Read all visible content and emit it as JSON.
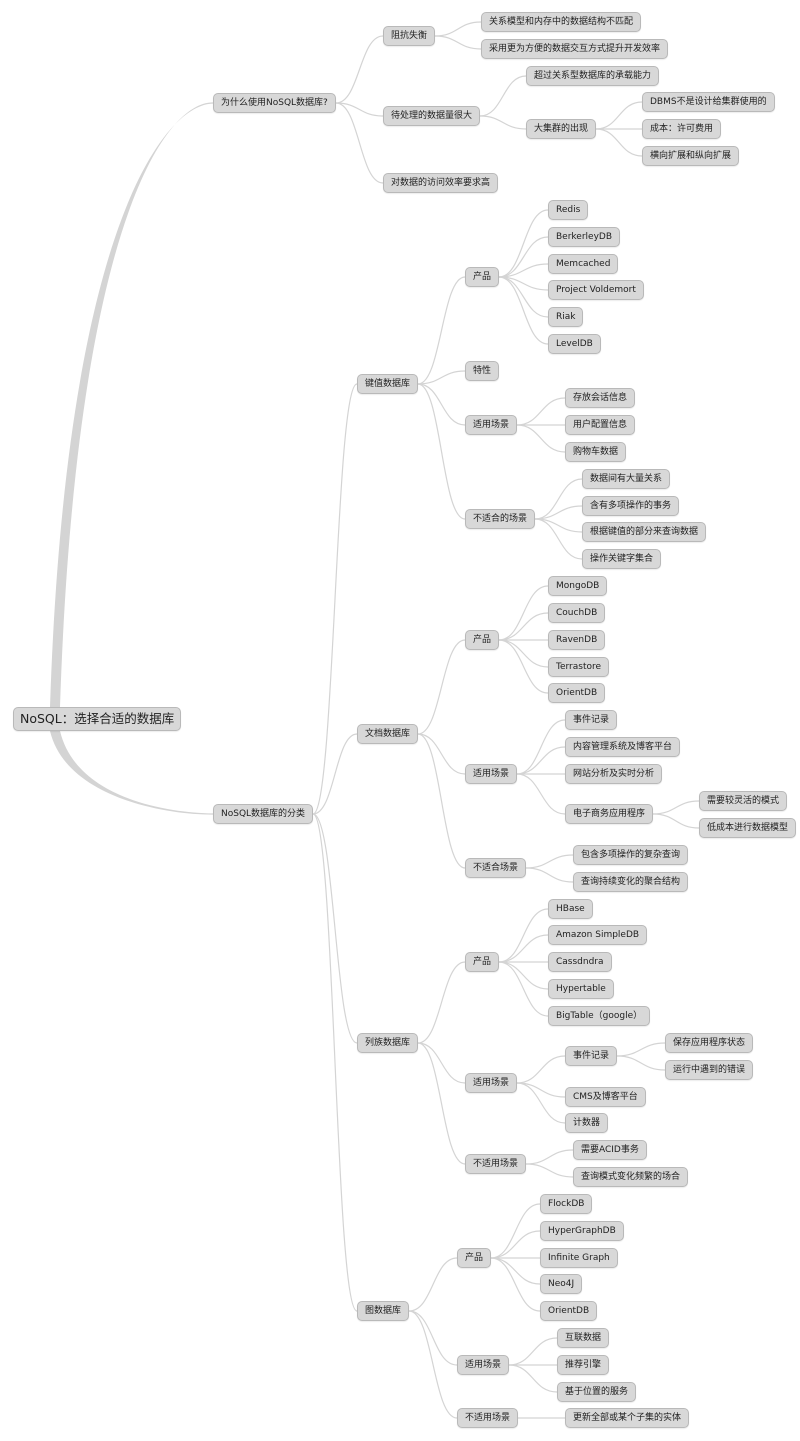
{
  "mindmap": {
    "title": "NoSQL：选择合适的数据库",
    "colors": {
      "node_fill": "#d8d8d8",
      "node_border": "#b9b9b9",
      "link": "#d4d4d4",
      "text": "#222222"
    },
    "root": {
      "id": "root",
      "label": "NoSQL：选择合适的数据库",
      "children": [
        {
          "id": "why",
          "label": "为什么使用NoSQL数据库?",
          "children": [
            {
              "id": "why-1",
              "label": "阻抗失衡",
              "children": [
                {
                  "id": "why-1-1",
                  "label": "关系模型和内存中的数据结构不匹配"
                },
                {
                  "id": "why-1-2",
                  "label": "采用更为方便的数据交互方式提升开发效率"
                }
              ]
            },
            {
              "id": "why-2",
              "label": "待处理的数据量很大",
              "children": [
                {
                  "id": "why-2-1",
                  "label": "超过关系型数据库的承载能力"
                },
                {
                  "id": "why-2-2",
                  "label": "大集群的出现",
                  "children": [
                    {
                      "id": "why-2-2-1",
                      "label": "DBMS不是设计给集群使用的"
                    },
                    {
                      "id": "why-2-2-2",
                      "label": "成本：许可费用"
                    },
                    {
                      "id": "why-2-2-3",
                      "label": "横向扩展和纵向扩展"
                    }
                  ]
                }
              ]
            },
            {
              "id": "why-3",
              "label": "对数据的访问效率要求高"
            }
          ]
        },
        {
          "id": "cat",
          "label": "NoSQL数据库的分类",
          "children": [
            {
              "id": "kv",
              "label": "键值数据库",
              "children": [
                {
                  "id": "kv-p",
                  "label": "产品",
                  "children": [
                    {
                      "id": "kv-p-1",
                      "label": "Redis"
                    },
                    {
                      "id": "kv-p-2",
                      "label": "BerkerleyDB"
                    },
                    {
                      "id": "kv-p-3",
                      "label": "Memcached"
                    },
                    {
                      "id": "kv-p-4",
                      "label": "Project Voldemort"
                    },
                    {
                      "id": "kv-p-5",
                      "label": "Riak"
                    },
                    {
                      "id": "kv-p-6",
                      "label": "LevelDB"
                    }
                  ]
                },
                {
                  "id": "kv-f",
                  "label": "特性"
                },
                {
                  "id": "kv-u",
                  "label": "适用场景",
                  "children": [
                    {
                      "id": "kv-u-1",
                      "label": "存放会话信息"
                    },
                    {
                      "id": "kv-u-2",
                      "label": "用户配置信息"
                    },
                    {
                      "id": "kv-u-3",
                      "label": "购物车数据"
                    }
                  ]
                },
                {
                  "id": "kv-n",
                  "label": "不适合的场景",
                  "children": [
                    {
                      "id": "kv-n-1",
                      "label": "数据间有大量关系"
                    },
                    {
                      "id": "kv-n-2",
                      "label": "含有多项操作的事务"
                    },
                    {
                      "id": "kv-n-3",
                      "label": "根据键值的部分来查询数据"
                    },
                    {
                      "id": "kv-n-4",
                      "label": "操作关键字集合"
                    }
                  ]
                }
              ]
            },
            {
              "id": "doc",
              "label": "文档数据库",
              "children": [
                {
                  "id": "doc-p",
                  "label": "产品",
                  "children": [
                    {
                      "id": "doc-p-1",
                      "label": "MongoDB"
                    },
                    {
                      "id": "doc-p-2",
                      "label": "CouchDB"
                    },
                    {
                      "id": "doc-p-3",
                      "label": "RavenDB"
                    },
                    {
                      "id": "doc-p-4",
                      "label": "Terrastore"
                    },
                    {
                      "id": "doc-p-5",
                      "label": "OrientDB"
                    }
                  ]
                },
                {
                  "id": "doc-u",
                  "label": "适用场景",
                  "children": [
                    {
                      "id": "doc-u-1",
                      "label": "事件记录"
                    },
                    {
                      "id": "doc-u-2",
                      "label": "内容管理系统及博客平台"
                    },
                    {
                      "id": "doc-u-3",
                      "label": "网站分析及实时分析"
                    },
                    {
                      "id": "doc-u-4",
                      "label": "电子商务应用程序",
                      "children": [
                        {
                          "id": "doc-u-4-1",
                          "label": "需要较灵活的模式"
                        },
                        {
                          "id": "doc-u-4-2",
                          "label": "低成本进行数据模型"
                        }
                      ]
                    }
                  ]
                },
                {
                  "id": "doc-n",
                  "label": "不适合场景",
                  "children": [
                    {
                      "id": "doc-n-1",
                      "label": "包含多项操作的复杂查询"
                    },
                    {
                      "id": "doc-n-2",
                      "label": "查询持续变化的聚合结构"
                    }
                  ]
                }
              ]
            },
            {
              "id": "col",
              "label": "列族数据库",
              "children": [
                {
                  "id": "col-p",
                  "label": "产品",
                  "children": [
                    {
                      "id": "col-p-1",
                      "label": "HBase"
                    },
                    {
                      "id": "col-p-2",
                      "label": "Amazon SimpleDB"
                    },
                    {
                      "id": "col-p-3",
                      "label": "Cassdndra"
                    },
                    {
                      "id": "col-p-4",
                      "label": "Hypertable"
                    },
                    {
                      "id": "col-p-5",
                      "label": "BigTable（google）"
                    }
                  ]
                },
                {
                  "id": "col-u",
                  "label": "适用场景",
                  "children": [
                    {
                      "id": "col-u-1",
                      "label": "事件记录",
                      "children": [
                        {
                          "id": "col-u-1-1",
                          "label": "保存应用程序状态"
                        },
                        {
                          "id": "col-u-1-2",
                          "label": "运行中遇到的错误"
                        }
                      ]
                    },
                    {
                      "id": "col-u-2",
                      "label": "CMS及博客平台"
                    },
                    {
                      "id": "col-u-3",
                      "label": "计数器"
                    }
                  ]
                },
                {
                  "id": "col-n",
                  "label": "不适用场景",
                  "children": [
                    {
                      "id": "col-n-1",
                      "label": "需要ACID事务"
                    },
                    {
                      "id": "col-n-2",
                      "label": "查询模式变化频繁的场合"
                    }
                  ]
                }
              ]
            },
            {
              "id": "graph",
              "label": "图数据库",
              "children": [
                {
                  "id": "graph-p",
                  "label": "产品",
                  "children": [
                    {
                      "id": "graph-p-1",
                      "label": "FlockDB"
                    },
                    {
                      "id": "graph-p-2",
                      "label": "HyperGraphDB"
                    },
                    {
                      "id": "graph-p-3",
                      "label": "Infinite Graph"
                    },
                    {
                      "id": "graph-p-4",
                      "label": "Neo4J"
                    },
                    {
                      "id": "graph-p-5",
                      "label": "OrientDB"
                    }
                  ]
                },
                {
                  "id": "graph-u",
                  "label": "适用场景",
                  "children": [
                    {
                      "id": "graph-u-1",
                      "label": "互联数据"
                    },
                    {
                      "id": "graph-u-2",
                      "label": "推荐引擎"
                    },
                    {
                      "id": "graph-u-3",
                      "label": "基于位置的服务"
                    }
                  ]
                },
                {
                  "id": "graph-n",
                  "label": "不适用场景",
                  "children": [
                    {
                      "id": "graph-n-1",
                      "label": "更新全部或某个子集的实体"
                    }
                  ]
                }
              ]
            }
          ]
        }
      ]
    }
  }
}
